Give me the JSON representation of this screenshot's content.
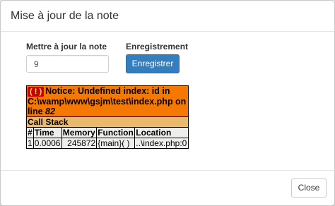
{
  "modal": {
    "title": "Mise à jour de la note"
  },
  "form": {
    "note_label": "Mettre à jour la note",
    "note_value": "9",
    "save_label": "Enregistrement",
    "save_button": "Enregistrer"
  },
  "xdebug": {
    "bang": "( ! )",
    "notice_text": "Notice: Undefined index: id in C:\\wamp\\www\\gsjm\\test\\index.php on line",
    "notice_line": "82",
    "call_stack_title": "Call Stack",
    "columns": [
      "#",
      "Time",
      "Memory",
      "Function",
      "Location"
    ],
    "rows": [
      {
        "num": "1",
        "time": "0.0006",
        "memory": "245872",
        "function": "{main}( )",
        "location": "..\\index.php:0"
      }
    ]
  },
  "footer": {
    "close_button": "Close"
  }
}
